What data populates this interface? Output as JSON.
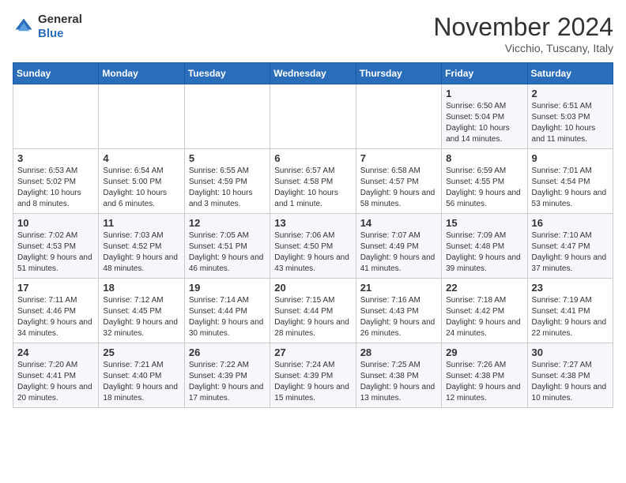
{
  "header": {
    "logo_line1": "General",
    "logo_line2": "Blue",
    "month_title": "November 2024",
    "subtitle": "Vicchio, Tuscany, Italy"
  },
  "days_of_week": [
    "Sunday",
    "Monday",
    "Tuesday",
    "Wednesday",
    "Thursday",
    "Friday",
    "Saturday"
  ],
  "weeks": [
    [
      {
        "day": "",
        "text": ""
      },
      {
        "day": "",
        "text": ""
      },
      {
        "day": "",
        "text": ""
      },
      {
        "day": "",
        "text": ""
      },
      {
        "day": "",
        "text": ""
      },
      {
        "day": "1",
        "text": "Sunrise: 6:50 AM\nSunset: 5:04 PM\nDaylight: 10 hours and 14 minutes."
      },
      {
        "day": "2",
        "text": "Sunrise: 6:51 AM\nSunset: 5:03 PM\nDaylight: 10 hours and 11 minutes."
      }
    ],
    [
      {
        "day": "3",
        "text": "Sunrise: 6:53 AM\nSunset: 5:02 PM\nDaylight: 10 hours and 8 minutes."
      },
      {
        "day": "4",
        "text": "Sunrise: 6:54 AM\nSunset: 5:00 PM\nDaylight: 10 hours and 6 minutes."
      },
      {
        "day": "5",
        "text": "Sunrise: 6:55 AM\nSunset: 4:59 PM\nDaylight: 10 hours and 3 minutes."
      },
      {
        "day": "6",
        "text": "Sunrise: 6:57 AM\nSunset: 4:58 PM\nDaylight: 10 hours and 1 minute."
      },
      {
        "day": "7",
        "text": "Sunrise: 6:58 AM\nSunset: 4:57 PM\nDaylight: 9 hours and 58 minutes."
      },
      {
        "day": "8",
        "text": "Sunrise: 6:59 AM\nSunset: 4:55 PM\nDaylight: 9 hours and 56 minutes."
      },
      {
        "day": "9",
        "text": "Sunrise: 7:01 AM\nSunset: 4:54 PM\nDaylight: 9 hours and 53 minutes."
      }
    ],
    [
      {
        "day": "10",
        "text": "Sunrise: 7:02 AM\nSunset: 4:53 PM\nDaylight: 9 hours and 51 minutes."
      },
      {
        "day": "11",
        "text": "Sunrise: 7:03 AM\nSunset: 4:52 PM\nDaylight: 9 hours and 48 minutes."
      },
      {
        "day": "12",
        "text": "Sunrise: 7:05 AM\nSunset: 4:51 PM\nDaylight: 9 hours and 46 minutes."
      },
      {
        "day": "13",
        "text": "Sunrise: 7:06 AM\nSunset: 4:50 PM\nDaylight: 9 hours and 43 minutes."
      },
      {
        "day": "14",
        "text": "Sunrise: 7:07 AM\nSunset: 4:49 PM\nDaylight: 9 hours and 41 minutes."
      },
      {
        "day": "15",
        "text": "Sunrise: 7:09 AM\nSunset: 4:48 PM\nDaylight: 9 hours and 39 minutes."
      },
      {
        "day": "16",
        "text": "Sunrise: 7:10 AM\nSunset: 4:47 PM\nDaylight: 9 hours and 37 minutes."
      }
    ],
    [
      {
        "day": "17",
        "text": "Sunrise: 7:11 AM\nSunset: 4:46 PM\nDaylight: 9 hours and 34 minutes."
      },
      {
        "day": "18",
        "text": "Sunrise: 7:12 AM\nSunset: 4:45 PM\nDaylight: 9 hours and 32 minutes."
      },
      {
        "day": "19",
        "text": "Sunrise: 7:14 AM\nSunset: 4:44 PM\nDaylight: 9 hours and 30 minutes."
      },
      {
        "day": "20",
        "text": "Sunrise: 7:15 AM\nSunset: 4:44 PM\nDaylight: 9 hours and 28 minutes."
      },
      {
        "day": "21",
        "text": "Sunrise: 7:16 AM\nSunset: 4:43 PM\nDaylight: 9 hours and 26 minutes."
      },
      {
        "day": "22",
        "text": "Sunrise: 7:18 AM\nSunset: 4:42 PM\nDaylight: 9 hours and 24 minutes."
      },
      {
        "day": "23",
        "text": "Sunrise: 7:19 AM\nSunset: 4:41 PM\nDaylight: 9 hours and 22 minutes."
      }
    ],
    [
      {
        "day": "24",
        "text": "Sunrise: 7:20 AM\nSunset: 4:41 PM\nDaylight: 9 hours and 20 minutes."
      },
      {
        "day": "25",
        "text": "Sunrise: 7:21 AM\nSunset: 4:40 PM\nDaylight: 9 hours and 18 minutes."
      },
      {
        "day": "26",
        "text": "Sunrise: 7:22 AM\nSunset: 4:39 PM\nDaylight: 9 hours and 17 minutes."
      },
      {
        "day": "27",
        "text": "Sunrise: 7:24 AM\nSunset: 4:39 PM\nDaylight: 9 hours and 15 minutes."
      },
      {
        "day": "28",
        "text": "Sunrise: 7:25 AM\nSunset: 4:38 PM\nDaylight: 9 hours and 13 minutes."
      },
      {
        "day": "29",
        "text": "Sunrise: 7:26 AM\nSunset: 4:38 PM\nDaylight: 9 hours and 12 minutes."
      },
      {
        "day": "30",
        "text": "Sunrise: 7:27 AM\nSunset: 4:38 PM\nDaylight: 9 hours and 10 minutes."
      }
    ]
  ]
}
